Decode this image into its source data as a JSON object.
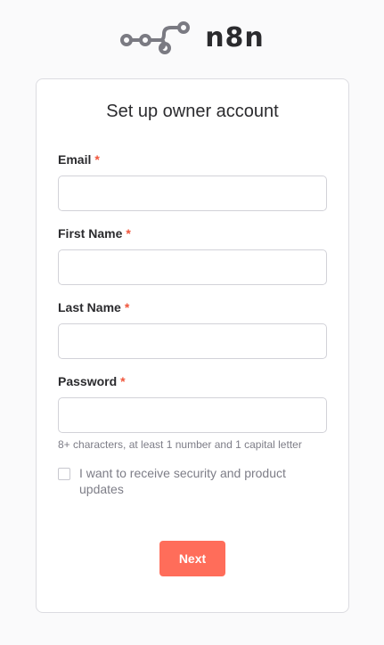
{
  "brand": {
    "name": "n8n",
    "logo_icon": "n8n-node-graph-icon"
  },
  "form": {
    "title": "Set up owner account",
    "fields": [
      {
        "label": "Email",
        "required_mark": "*",
        "value": "",
        "placeholder": ""
      },
      {
        "label": "First Name",
        "required_mark": "*",
        "value": "",
        "placeholder": ""
      },
      {
        "label": "Last Name",
        "required_mark": "*",
        "value": "",
        "placeholder": ""
      },
      {
        "label": "Password",
        "required_mark": "*",
        "value": "",
        "placeholder": ""
      }
    ],
    "password_hint": "8+ characters, at least 1 number and 1 capital letter",
    "updates_checkbox": {
      "label": "I want to receive security and product updates",
      "checked": false
    },
    "submit_label": "Next"
  },
  "colors": {
    "accent": "#ff6d5a",
    "required": "#f0563c",
    "text": "#2b2b2e",
    "muted": "#7d7d87"
  }
}
